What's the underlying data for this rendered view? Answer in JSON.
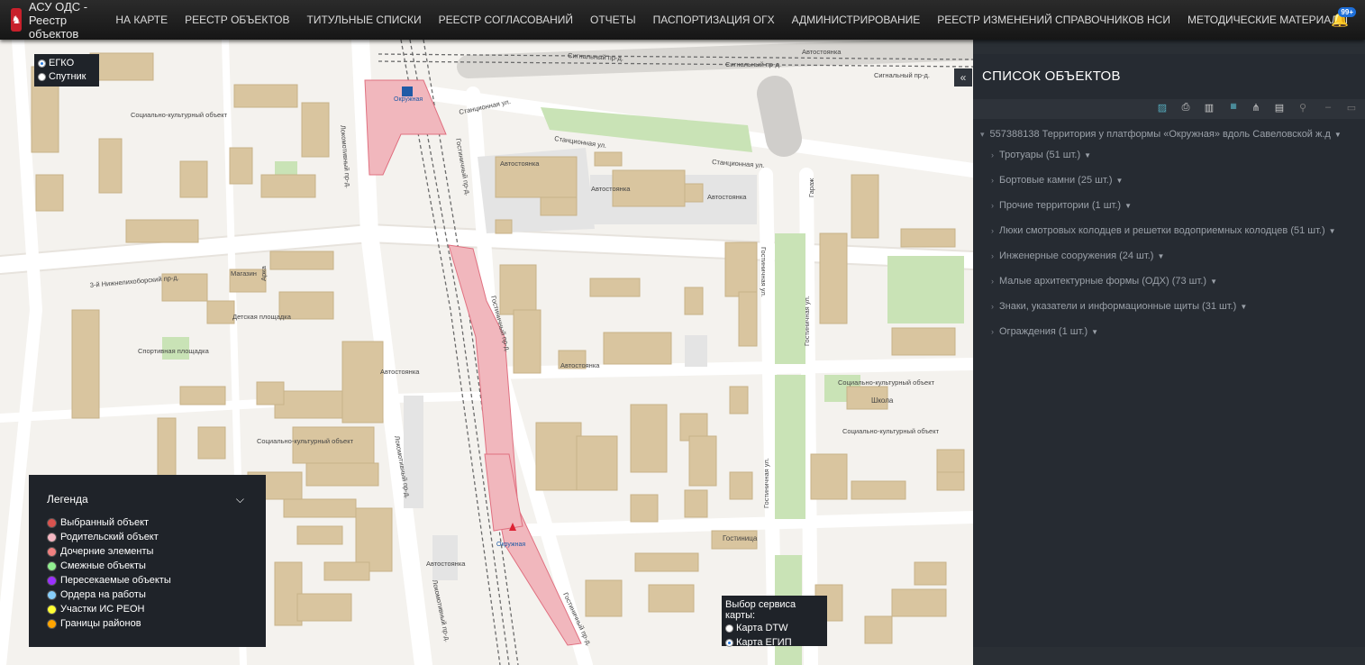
{
  "app": {
    "logo_glyph": "♞",
    "title": "АСУ ОДС - Реестр объектов"
  },
  "nav": [
    "НА КАРТЕ",
    "РЕЕСТР ОБЪЕКТОВ",
    "ТИТУЛЬНЫЕ СПИСКИ",
    "РЕЕСТР СОГЛАСОВАНИЙ",
    "ОТЧЕТЫ",
    "ПАСПОРТИЗАЦИЯ ОГХ",
    "АДМИНИСТРИРОВАНИЕ",
    "РЕЕСТР ИЗМЕНЕНИЙ СПРАВОЧНИКОВ НСИ",
    "МЕТОДИЧЕСКИЕ МАТЕРИАЛЫ"
  ],
  "notifications": {
    "count": "99+"
  },
  "layers": {
    "egko": "ЕГКО",
    "sputnik": "Спутник"
  },
  "map_labels": {
    "okruzhnaya": "Окружная",
    "okruzhnaya2": "Окружная",
    "stantsionnaya1": "Станционная ул.",
    "stantsionnaya2": "Станционная ул.",
    "stantsionnaya3": "Станционная ул.",
    "signalny1": "Сигнальный пр-д.",
    "signalny2": "Сигнальный пр-д.",
    "signalny3": "Сигнальный пр-д.",
    "lokomotivny1": "Локомотивный пр-д.",
    "lokomotivny2": "Локомотивный пр-д.",
    "lokomotivny3": "Локомотивный пр-д.",
    "gostinichny1": "Гостиничный пр-д.",
    "gostinichny2": "Гостиничный пр-д.",
    "gostinichny3": "Гостиничный пр-д.",
    "gostinichnaya1": "Гостиничная ул.",
    "gostinichnaya2": "Гостиничная ул.",
    "gostinichnaya3": "Гостиничная ул.",
    "nizhnelikhoborsky": "3-й Нижнелихоборский пр-д.",
    "autostoyanka": "Автостоянка",
    "sotskult": "Социально-культурный объект",
    "detskaya": "Детская площадка",
    "sportivnaya": "Спортивная площадка",
    "magazin": "Магазин",
    "shkola": "Школа",
    "gostinitsa": "Гостиница",
    "garazh": "Гараж",
    "arka": "Арка"
  },
  "legend": {
    "title": "Легенда",
    "items": [
      {
        "label": "Выбранный объект",
        "color": "#d9534f"
      },
      {
        "label": "Родительский объект",
        "color": "#f4b6c2"
      },
      {
        "label": "Дочерние элементы",
        "color": "#f08080"
      },
      {
        "label": "Смежные объекты",
        "color": "#90ee90"
      },
      {
        "label": "Пересекаемые объекты",
        "color": "#9b30ff"
      },
      {
        "label": "Ордера на работы",
        "color": "#87cefa"
      },
      {
        "label": "Участки ИС РЕОН",
        "color": "#ffff33"
      },
      {
        "label": "Границы районов",
        "color": "#ffa500"
      }
    ]
  },
  "map_service": {
    "title": "Выбор сервиса карты:",
    "dtw": "Карта DTW",
    "egip": "Карта ЕГИП"
  },
  "panel": {
    "title": "СПИСОК ОБЪЕКТОВ",
    "root": "557388138 Территория у платформы «Окружная» вдоль Савеловской ж.д",
    "items": [
      "Тротуары (51 шт.)",
      "Бортовые камни (25 шт.)",
      "Прочие территории (1 шт.)",
      "Люки смотровых колодцев и решетки водоприемных колодцев (51 шт.)",
      "Инженерные сооружения (24 шт.)",
      "Малые архитектурные формы (ОДХ) (73 шт.)",
      "Знаки, указатели и информационные щиты (31 шт.)",
      "Ограждения (1 шт.)"
    ]
  }
}
